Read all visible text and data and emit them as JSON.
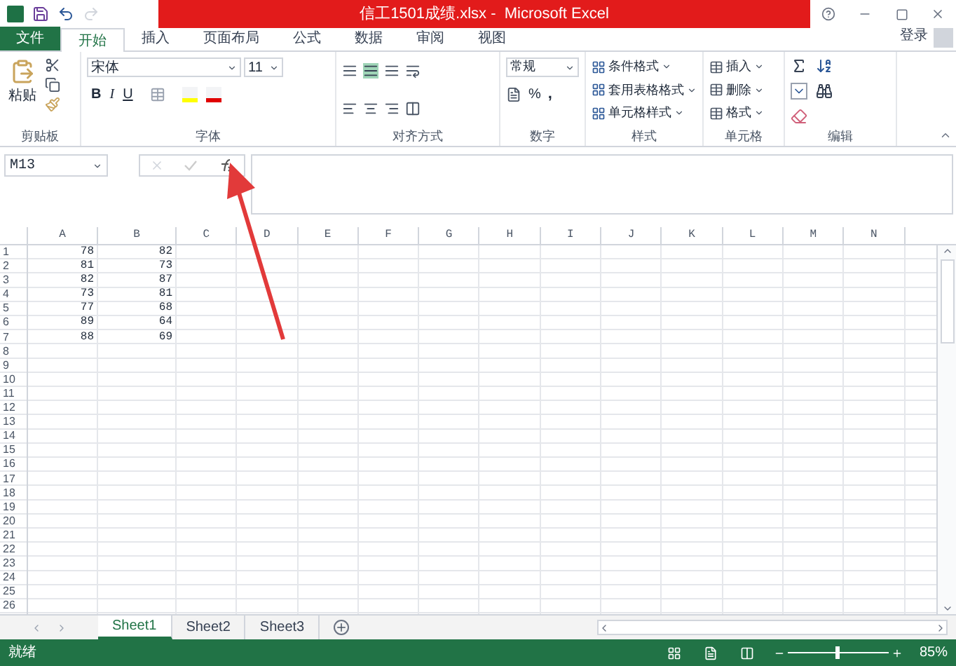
{
  "window": {
    "title": "信工1501成绩.xlsx -  Microsoft Excel",
    "login": "登录"
  },
  "tabs": [
    {
      "label": "文件",
      "kind": "file",
      "selected": false
    },
    {
      "label": "开始",
      "kind": "tab",
      "selected": true
    },
    {
      "label": "插入",
      "kind": "tab",
      "selected": false
    },
    {
      "label": "页面布局",
      "kind": "tab",
      "selected": false
    },
    {
      "label": "公式",
      "kind": "tab",
      "selected": false
    },
    {
      "label": "数据",
      "kind": "tab",
      "selected": false
    },
    {
      "label": "审阅",
      "kind": "tab",
      "selected": false
    },
    {
      "label": "视图",
      "kind": "tab",
      "selected": false
    }
  ],
  "ribbon": {
    "clipboard": {
      "paste": "粘贴",
      "label": "剪贴板"
    },
    "font": {
      "name": "宋体",
      "size": "11",
      "bold": "B",
      "italic": "I",
      "underline": "U",
      "label": "字体"
    },
    "alignment": {
      "label": "对齐方式"
    },
    "number": {
      "format": "常规",
      "percent": "%",
      "comma": ",",
      "label": "数字"
    },
    "styles": {
      "items": [
        "条件格式",
        "套用表格格式",
        "单元格样式"
      ],
      "label": "样式"
    },
    "cells": {
      "items": [
        "插入",
        "删除",
        "格式"
      ],
      "label": "单元格"
    },
    "editing": {
      "label": "编辑"
    }
  },
  "formula_bar": {
    "name_box": "M13"
  },
  "sheet": {
    "columns": [
      "A",
      "B",
      "C",
      "D",
      "E",
      "F",
      "G",
      "H",
      "I",
      "J",
      "K",
      "L",
      "M",
      "N"
    ],
    "rows": [
      {
        "header": "1",
        "cells": [
          "78",
          "82"
        ]
      },
      {
        "header": "2",
        "cells": [
          "81",
          "73"
        ]
      },
      {
        "header": "3",
        "cells": [
          "82",
          "87"
        ]
      },
      {
        "header": "4",
        "cells": [
          "73",
          "81"
        ]
      },
      {
        "header": "5",
        "cells": [
          "77",
          "68"
        ]
      },
      {
        "header": "6",
        "cells": [
          "89",
          "64"
        ]
      },
      {
        "header": "7",
        "cells": [
          "88",
          "69"
        ]
      },
      {
        "header": "8",
        "cells": []
      },
      {
        "header": "9",
        "cells": []
      },
      {
        "header": "10",
        "cells": []
      },
      {
        "header": "11",
        "cells": []
      },
      {
        "header": "12",
        "cells": []
      },
      {
        "header": "13",
        "cells": []
      },
      {
        "header": "14",
        "cells": []
      },
      {
        "header": "15",
        "cells": []
      },
      {
        "header": "16",
        "cells": []
      },
      {
        "header": "17",
        "cells": []
      },
      {
        "header": "18",
        "cells": []
      },
      {
        "header": "19",
        "cells": []
      },
      {
        "header": "20",
        "cells": []
      },
      {
        "header": "21",
        "cells": []
      },
      {
        "header": "22",
        "cells": []
      },
      {
        "header": "23",
        "cells": []
      },
      {
        "header": "24",
        "cells": []
      },
      {
        "header": "25",
        "cells": []
      },
      {
        "header": "26",
        "cells": []
      }
    ]
  },
  "sheet_tabs": [
    {
      "label": "Sheet1",
      "selected": true
    },
    {
      "label": "Sheet2",
      "selected": false
    },
    {
      "label": "Sheet3",
      "selected": false
    }
  ],
  "status_bar": {
    "text": "就绪",
    "zoom": {
      "level": 0.5,
      "reading": "85%"
    }
  }
}
